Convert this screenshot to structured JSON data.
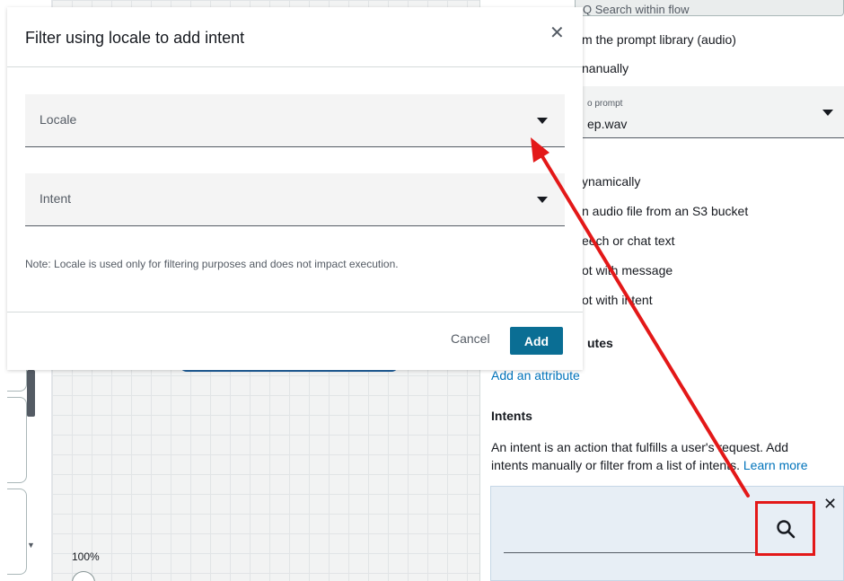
{
  "modal": {
    "title": "Filter using locale to add intent",
    "close_glyph": "✕",
    "locale_label": "Locale",
    "intent_label": "Intent",
    "note": "Note: Locale is used only for filtering purposes and does not impact execution.",
    "cancel_label": "Cancel",
    "add_label": "Add"
  },
  "right_panel": {
    "search_partial": "Q  Search within flow",
    "radio_options": [
      "m the prompt library (audio)",
      "nanually",
      "ynamically",
      "n audio file from an S3 bucket",
      "eech or chat text",
      "ot with message",
      "ot with intent"
    ],
    "prompt_small_label": "o prompt",
    "prompt_value": "ep.wav",
    "attributes_heading_partial": "utes",
    "add_attribute_link": "Add an attribute",
    "intents_heading": "Intents",
    "intents_desc_line1": "An intent is an action that fulfills a user's request. Add",
    "intents_desc_line2": "intents manually or filter from a list of intents.",
    "learn_more": "Learn more",
    "intent_close_glyph": "✕"
  },
  "canvas": {
    "zoom": "100%"
  },
  "colors": {
    "accent_button": "#0a6e94",
    "link": "#0073bb",
    "annotation_red": "#e31818"
  },
  "icons": {
    "search": "search-icon",
    "close": "close-icon",
    "caret": "caret-down-icon"
  }
}
